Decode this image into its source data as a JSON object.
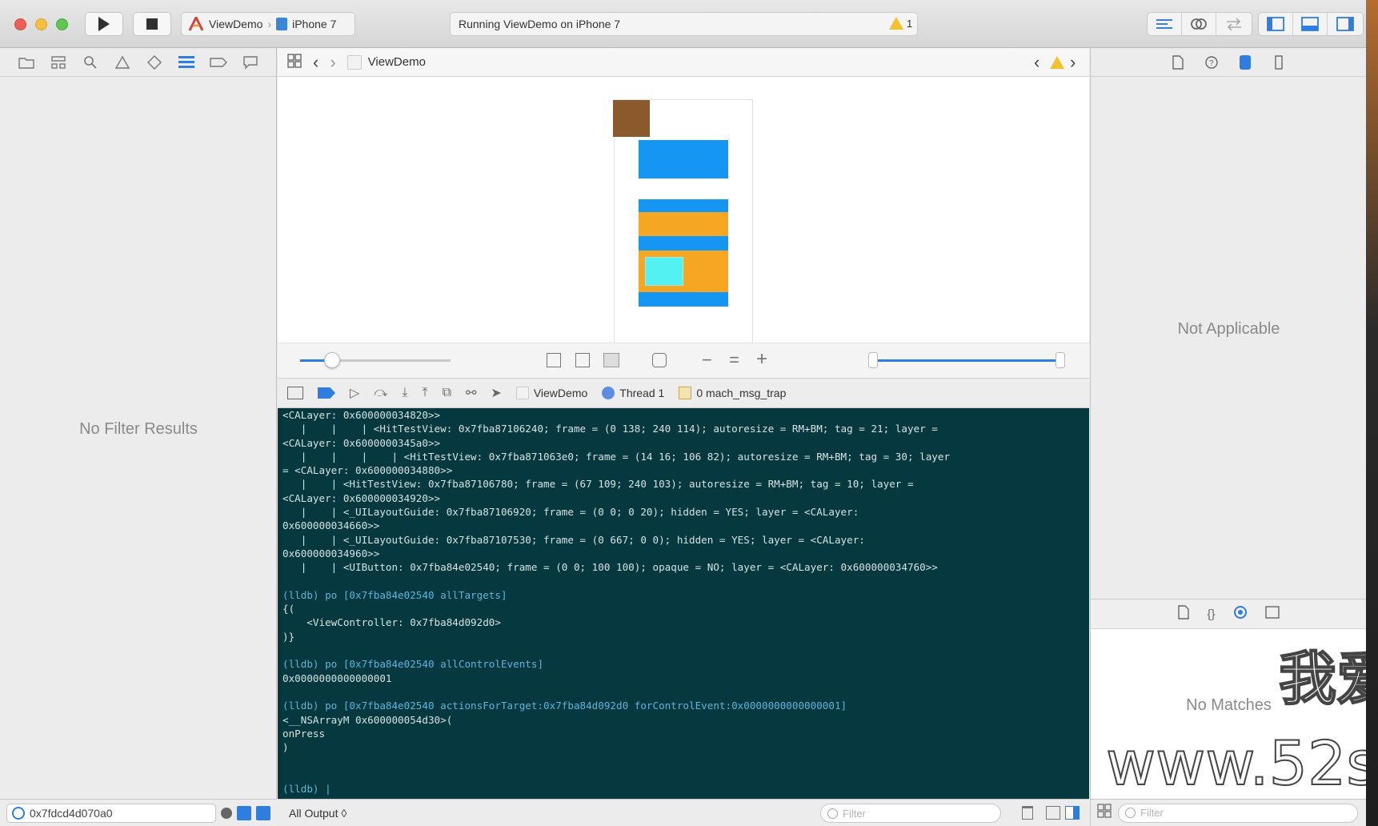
{
  "toolbar": {
    "scheme_target": "ViewDemo",
    "scheme_device": "iPhone 7",
    "activity_text": "Running ViewDemo on iPhone 7",
    "warning_count": "1"
  },
  "navigator": {
    "empty_text": "No Filter Results",
    "filter_value": "0x7fdcd4d070a0"
  },
  "editor": {
    "jump_title": "ViewDemo",
    "debug_breadcrumb": {
      "app": "ViewDemo",
      "thread": "Thread 1",
      "frame": "0 mach_msg_trap"
    },
    "output_selector": "All Output ◊",
    "filter_placeholder": "Filter"
  },
  "console": {
    "lines": [
      {
        "text": "<CALayer: 0x600000034820>>",
        "kind": "out"
      },
      {
        "text": "   |    |    | <HitTestView: 0x7fba87106240; frame = (0 138; 240 114); autoresize = RM+BM; tag = 21; layer =",
        "kind": "out"
      },
      {
        "text": "<CALayer: 0x6000000345a0>>",
        "kind": "out"
      },
      {
        "text": "   |    |    |    | <HitTestView: 0x7fba871063e0; frame = (14 16; 106 82); autoresize = RM+BM; tag = 30; layer",
        "kind": "out"
      },
      {
        "text": "= <CALayer: 0x600000034880>>",
        "kind": "out"
      },
      {
        "text": "   |    | <HitTestView: 0x7fba87106780; frame = (67 109; 240 103); autoresize = RM+BM; tag = 10; layer =",
        "kind": "out"
      },
      {
        "text": "<CALayer: 0x600000034920>>",
        "kind": "out"
      },
      {
        "text": "   |    | <_UILayoutGuide: 0x7fba87106920; frame = (0 0; 0 20); hidden = YES; layer = <CALayer:",
        "kind": "out"
      },
      {
        "text": "0x600000034660>>",
        "kind": "out"
      },
      {
        "text": "   |    | <_UILayoutGuide: 0x7fba87107530; frame = (0 667; 0 0); hidden = YES; layer = <CALayer:",
        "kind": "out"
      },
      {
        "text": "0x600000034960>>",
        "kind": "out"
      },
      {
        "text": "   |    | <UIButton: 0x7fba84e02540; frame = (0 0; 100 100); opaque = NO; layer = <CALayer: 0x600000034760>>",
        "kind": "out"
      },
      {
        "text": "",
        "kind": "out"
      },
      {
        "text": "(lldb) po [0x7fba84e02540 allTargets]",
        "kind": "cmd"
      },
      {
        "text": "{(",
        "kind": "out"
      },
      {
        "text": "    <ViewController: 0x7fba84d092d0>",
        "kind": "out"
      },
      {
        "text": ")}",
        "kind": "out"
      },
      {
        "text": "",
        "kind": "out"
      },
      {
        "text": "(lldb) po [0x7fba84e02540 allControlEvents]",
        "kind": "cmd"
      },
      {
        "text": "0x0000000000000001",
        "kind": "out"
      },
      {
        "text": "",
        "kind": "out"
      },
      {
        "text": "(lldb) po [0x7fba84e02540 actionsForTarget:0x7fba84d092d0 forControlEvent:0x0000000000000001]",
        "kind": "cmd"
      },
      {
        "text": "<__NSArrayM 0x600000054d30>(",
        "kind": "out"
      },
      {
        "text": "onPress",
        "kind": "out"
      },
      {
        "text": ")",
        "kind": "out"
      },
      {
        "text": "",
        "kind": "out"
      },
      {
        "text": "",
        "kind": "out"
      },
      {
        "text": "(lldb) |",
        "kind": "cmd"
      }
    ]
  },
  "inspector": {
    "not_applicable": "Not Applicable",
    "library_empty": "No Matches",
    "filter_placeholder": "Filter"
  },
  "watermark": {
    "top": "我爱",
    "bottom": "www.52s"
  },
  "colors": {
    "console_bg": "#06393f",
    "view_brown": "#8b5a2b",
    "view_blue": "#1496f2",
    "view_orange": "#f5a623",
    "view_cyan": "#53f1f1",
    "accent": "#1e7fe0"
  }
}
